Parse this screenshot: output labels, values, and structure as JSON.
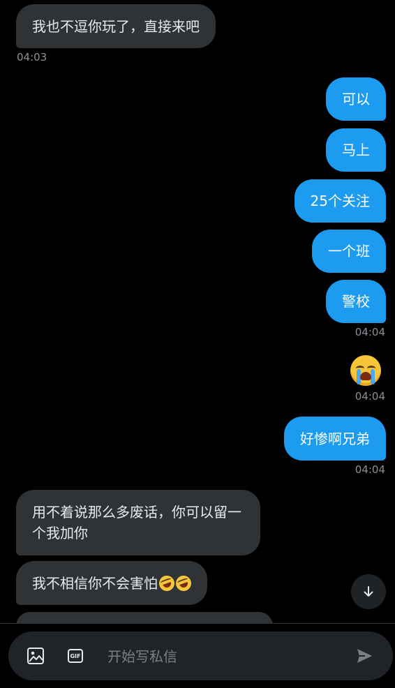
{
  "messages": {
    "m1": {
      "text": "我也不逗你玩了，直接来吧",
      "time": "04:03"
    },
    "m2": {
      "text": "可以"
    },
    "m3": {
      "text": "马上"
    },
    "m4": {
      "text": "25个关注"
    },
    "m5": {
      "text": "一个班"
    },
    "m6": {
      "text": "警校",
      "time": "04:04"
    },
    "m7": {
      "emoji": "loudly-crying-face",
      "time": "04:04"
    },
    "m8": {
      "text": "好惨啊兄弟",
      "time": "04:04"
    },
    "m9": {
      "text": "用不着说那么多废话，你可以留一个我加你"
    },
    "m10": {
      "text": "我不相信你不会害怕",
      "emoji": "rolling-on-the-floor-laughing x2"
    }
  },
  "composer": {
    "placeholder": "开始写私信",
    "gif_label": "GIF"
  },
  "colors": {
    "incoming_bubble": "#2f3336",
    "outgoing_bubble": "#1d9bf0",
    "background": "#000000"
  }
}
